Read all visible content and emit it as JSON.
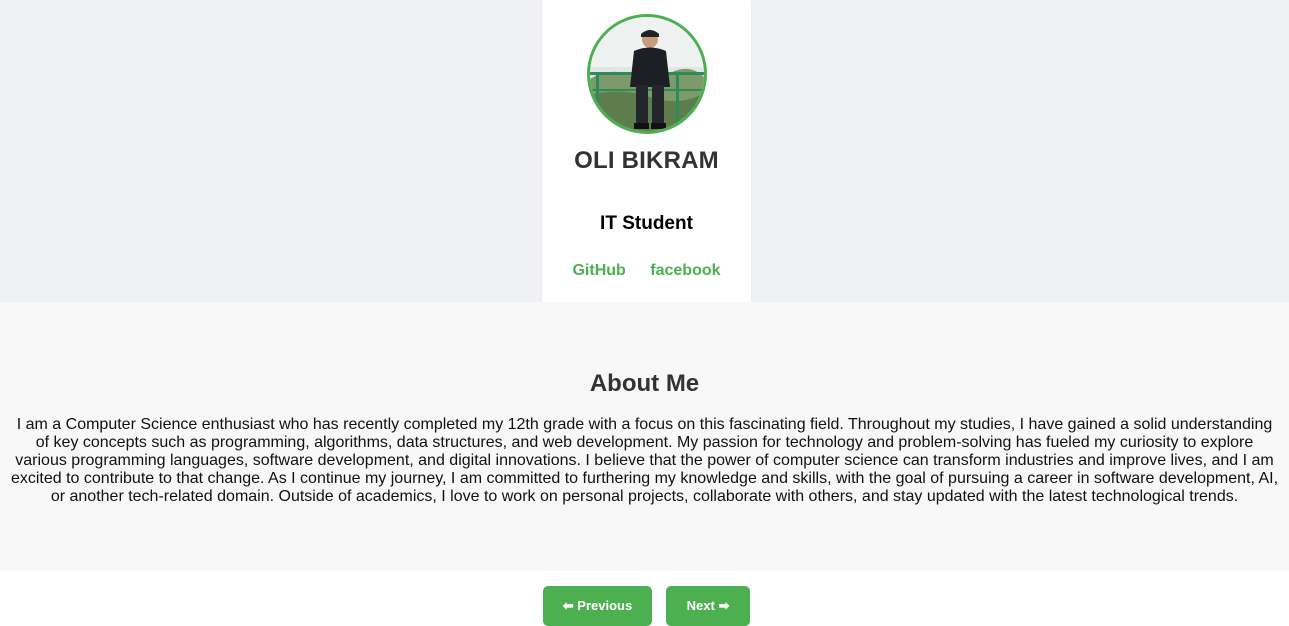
{
  "profile": {
    "name": "OLI BIKRAM",
    "role": "IT Student",
    "links": [
      {
        "label": "GitHub"
      },
      {
        "label": "facebook"
      }
    ]
  },
  "about": {
    "title": "About Me",
    "text": "I am a Computer Science enthusiast who has recently completed my 12th grade with a focus on this fascinating field. Throughout my studies, I have gained a solid understanding of key concepts such as programming, algorithms, data structures, and web development. My passion for technology and problem-solving has fueled my curiosity to explore various programming languages, software development, and digital innovations. I believe that the power of computer science can transform industries and improve lives, and I am excited to contribute to that change. As I continue my journey, I am committed to furthering my knowledge and skills, with the goal of pursuing a career in software development, AI, or another tech-related domain. Outside of academics, I love to work on personal projects, collaborate with others, and stay updated with the latest technological trends."
  },
  "navigation": {
    "previous_label": "⬅ Previous",
    "next_label": "Next ➡"
  },
  "colors": {
    "accent": "#4caf50",
    "top_background": "#f0f1f5",
    "about_background": "#f8f8f8"
  }
}
